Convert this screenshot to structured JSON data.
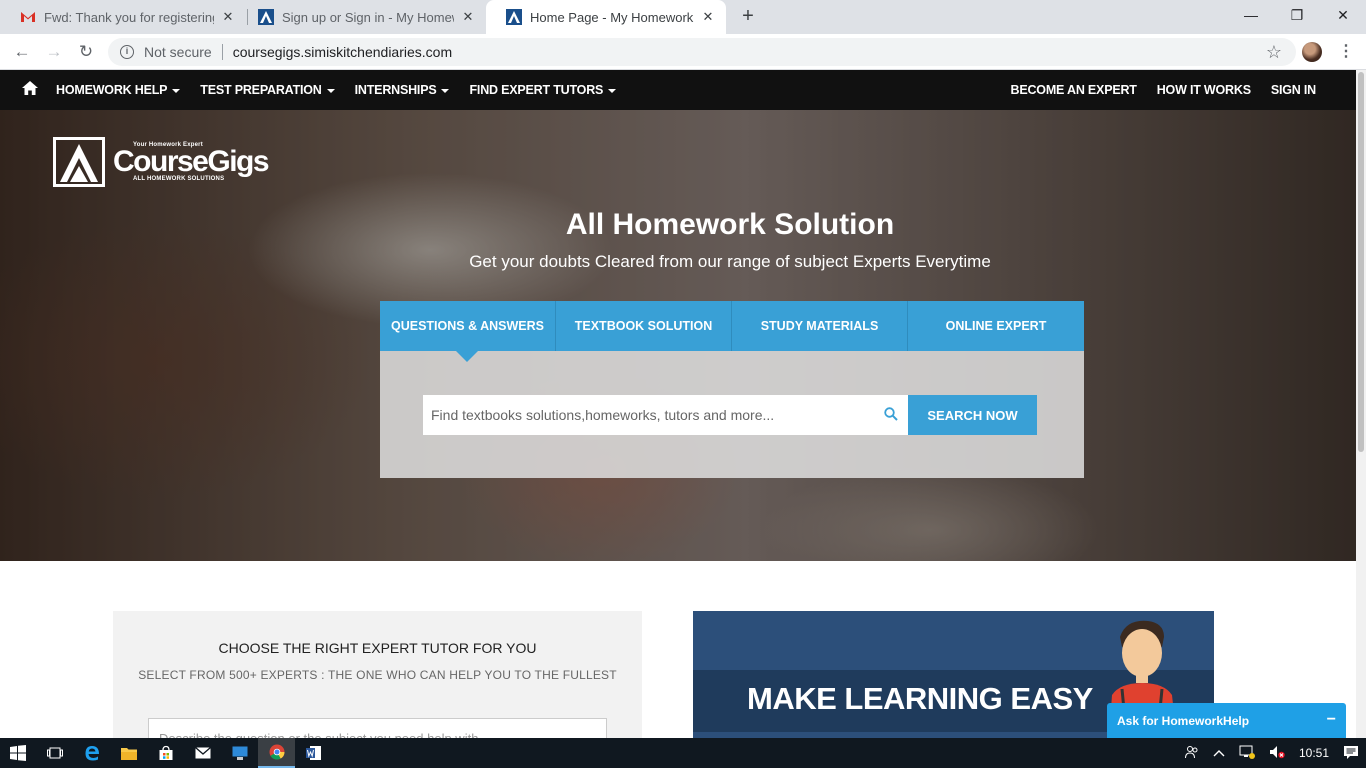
{
  "browser": {
    "tabs": [
      {
        "title": "Fwd: Thank you for registering as",
        "favicon": "gmail-icon",
        "active": false
      },
      {
        "title": "Sign up or Sign in - My Homewo",
        "favicon": "coursegigs-icon",
        "active": false
      },
      {
        "title": "Home Page - My Homework Exp",
        "favicon": "coursegigs-icon",
        "active": true
      }
    ],
    "new_tab": "+",
    "window_controls": {
      "minimize": "—",
      "restore": "❐",
      "close": "✕"
    },
    "security_label": "Not secure",
    "url": "coursegigs.simiskitchendiaries.com"
  },
  "site": {
    "nav": {
      "left": [
        "HOMEWORK HELP",
        "TEST PREPARATION",
        "INTERNSHIPS",
        "FIND EXPERT TUTORS"
      ],
      "right": [
        "BECOME AN EXPERT",
        "HOW IT WORKS",
        "SIGN IN"
      ]
    },
    "logo": {
      "tagline_top": "Your Homework Expert",
      "brand": "CourseGigs",
      "tagline_bottom": "ALL HOMEWORK SOLUTIONS"
    },
    "hero": {
      "title": "All Homework Solution",
      "subtitle": "Get your doubts Cleared from our range of subject Experts Everytime",
      "tabs": [
        "QUESTIONS & ANSWERS",
        "TEXTBOOK SOLUTION",
        "STUDY MATERIALS",
        "ONLINE EXPERT"
      ],
      "search_placeholder": "Find textbooks solutions,homeworks, tutors and more...",
      "search_button": "SEARCH NOW"
    },
    "tutor": {
      "heading": "CHOOSE THE RIGHT EXPERT TUTOR FOR YOU",
      "subheading": "SELECT FROM 500+ EXPERTS : THE ONE WHO CAN HELP YOU TO THE FULLEST",
      "textarea_placeholder": "Describe the question or the subject you need help with"
    },
    "promo": {
      "text": "MAKE LEARNING EASY"
    },
    "chat": {
      "label": "Ask for HomeworkHelp",
      "minimize": "−"
    }
  },
  "taskbar": {
    "time": "10:51"
  }
}
